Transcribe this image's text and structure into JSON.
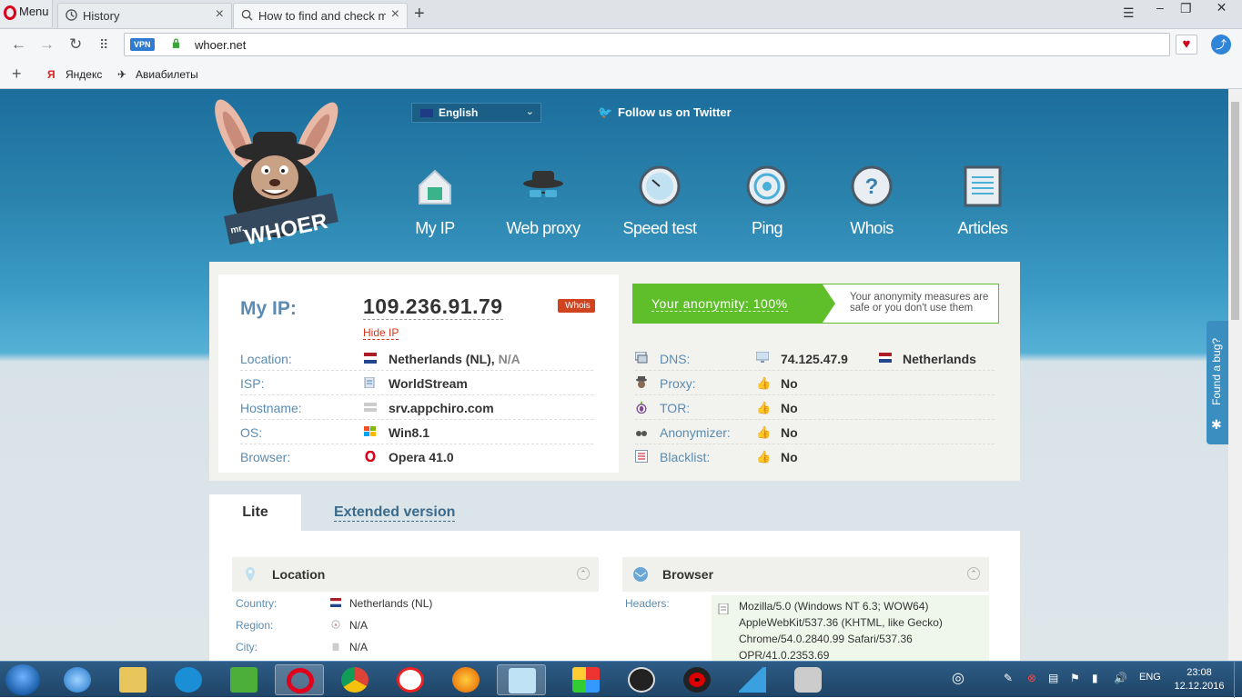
{
  "browser": {
    "menu_label": "Menu",
    "tabs": [
      {
        "label": "History"
      },
      {
        "label": "How to find and check my"
      }
    ],
    "vpn_badge": "VPN",
    "url": "whoer.net",
    "bookmarks": [
      {
        "label": "Яндекс"
      },
      {
        "label": "Авиабилеты"
      }
    ]
  },
  "header": {
    "language": "English",
    "twitter": "Follow us on Twitter",
    "logo_text": "mr. WHOER",
    "nav": [
      {
        "label": "My IP",
        "icon": "house-icon"
      },
      {
        "label": "Web proxy",
        "icon": "spy-hat-icon"
      },
      {
        "label": "Speed test",
        "icon": "speedometer-icon"
      },
      {
        "label": "Ping",
        "icon": "ping-icon"
      },
      {
        "label": "Whois",
        "icon": "question-icon"
      },
      {
        "label": "Articles",
        "icon": "article-icon"
      }
    ]
  },
  "ip_panel": {
    "title": "My IP:",
    "ip": "109.236.91.79",
    "hide_ip": "Hide IP",
    "whois": "Whois",
    "rows": [
      {
        "key": "Location:",
        "value": "Netherlands (NL),",
        "extra": "N/A",
        "icon": "flag-nl-icon"
      },
      {
        "key": "ISP:",
        "value": "WorldStream",
        "icon": "isp-icon"
      },
      {
        "key": "Hostname:",
        "value": "srv.appchiro.com",
        "icon": "server-icon"
      },
      {
        "key": "OS:",
        "value": "Win8.1",
        "icon": "windows-icon"
      },
      {
        "key": "Browser:",
        "value": "Opera 41.0",
        "icon": "opera-icon"
      }
    ]
  },
  "anonymity": {
    "score": "Your anonymity: 100%",
    "note": "Your anonymity measures are safe or you don't use them",
    "rows": [
      {
        "key": "DNS:",
        "value": "74.125.47.9",
        "country": "Netherlands",
        "icon": "dns-icon"
      },
      {
        "key": "Proxy:",
        "value": "No",
        "icon": "spy-icon"
      },
      {
        "key": "TOR:",
        "value": "No",
        "icon": "tor-onion-icon"
      },
      {
        "key": "Anonymizer:",
        "value": "No",
        "icon": "glasses-icon"
      },
      {
        "key": "Blacklist:",
        "value": "No",
        "icon": "list-icon"
      }
    ]
  },
  "tabs": {
    "lite": "Lite",
    "extended": "Extended version"
  },
  "location_section": {
    "title": "Location",
    "rows": [
      {
        "key": "Country:",
        "value": "Netherlands (NL)"
      },
      {
        "key": "Region:",
        "value": "N/A"
      },
      {
        "key": "City:",
        "value": "N/A"
      }
    ]
  },
  "browser_section": {
    "title": "Browser",
    "headers_label": "Headers:",
    "headers": [
      "Mozilla/5.0 (Windows NT 6.3; WOW64)",
      "AppleWebKit/537.36 (KHTML, like Gecko)",
      "Chrome/54.0.2840.99 Safari/537.36",
      "OPR/41.0.2353.69"
    ]
  },
  "bug_tab": "Found a bug?",
  "taskbar": {
    "language": "ENG",
    "time": "23:08",
    "date": "12.12.2016"
  },
  "colors": {
    "accent_green": "#5fbf2b",
    "header_blue": "#2a83ad",
    "label_blue": "#5b8bb0",
    "opera_red": "#d9001b"
  }
}
